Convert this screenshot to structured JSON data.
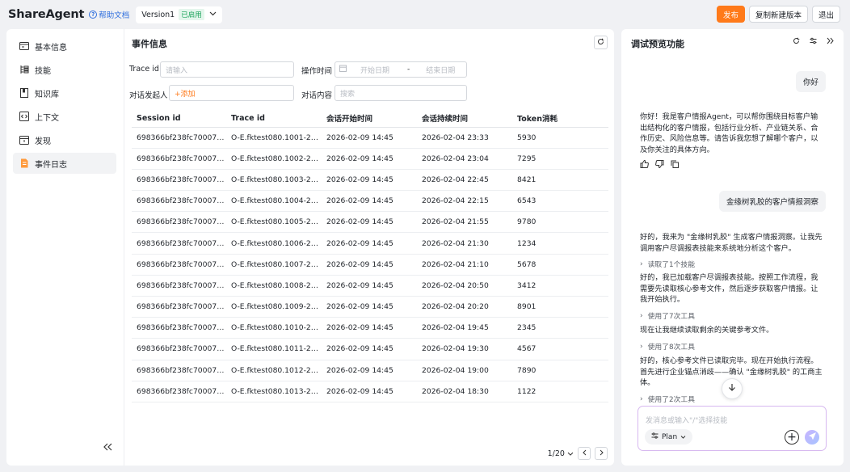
{
  "header": {
    "brand": "ShareAgent",
    "help_label": "帮助文档",
    "version_label": "Version1",
    "version_status": "已启用",
    "publish_label": "发布",
    "copy_label": "复制新建版本",
    "exit_label": "退出",
    "colors": {
      "accent": "#ff7a1a",
      "link": "#2f6fde",
      "status": "#1aa35a"
    }
  },
  "sidebar": {
    "items": [
      {
        "label": "基本信息",
        "icon": "info-card-icon"
      },
      {
        "label": "技能",
        "icon": "skill-list-icon"
      },
      {
        "label": "知识库",
        "icon": "book-icon"
      },
      {
        "label": "上下文",
        "icon": "code-icon"
      },
      {
        "label": "发现",
        "icon": "calendar-icon"
      },
      {
        "label": "事件日志",
        "icon": "log-document-icon",
        "active": true
      }
    ],
    "collapse_icon": "double-chevron-left-icon"
  },
  "main": {
    "title": "事件信息",
    "filters": {
      "trace_label": "Trace id",
      "trace_placeholder": "请输入",
      "time_label": "操作时间",
      "start_placeholder": "开始日期",
      "range_sep": "-",
      "end_placeholder": "结束日期",
      "initiator_label": "对话发起人",
      "initiator_add": "+添加",
      "content_label": "对话内容",
      "content_placeholder": "搜索"
    },
    "columns": [
      "Session id",
      "Trace id",
      "会话开始时间",
      "会话持续时间",
      "Token消耗"
    ],
    "rows": [
      [
        "698366bf238fc70007c…",
        "O-E.fktest080.1001-26…",
        "2026-02-09 14:45",
        "2026-02-04 23:33",
        "5930"
      ],
      [
        "698366bf238fc70007c…",
        "O-E.fktest080.1002-26…",
        "2026-02-09 14:45",
        "2026-02-04 23:04",
        "7295"
      ],
      [
        "698366bf238fc70007c…",
        "O-E.fktest080.1003-26…",
        "2026-02-09 14:45",
        "2026-02-04 22:45",
        "8421"
      ],
      [
        "698366bf238fc70007c…",
        "O-E.fktest080.1004-26…",
        "2026-02-09 14:45",
        "2026-02-04 22:15",
        "6543"
      ],
      [
        "698366bf238fc70007c…",
        "O-E.fktest080.1005-26…",
        "2026-02-09 14:45",
        "2026-02-04 21:55",
        "9780"
      ],
      [
        "698366bf238fc70007c…",
        "O-E.fktest080.1006-26…",
        "2026-02-09 14:45",
        "2026-02-04 21:30",
        "1234"
      ],
      [
        "698366bf238fc70007c…",
        "O-E.fktest080.1007-26…",
        "2026-02-09 14:45",
        "2026-02-04 21:10",
        "5678"
      ],
      [
        "698366bf238fc70007c…",
        "O-E.fktest080.1008-26…",
        "2026-02-09 14:45",
        "2026-02-04 20:50",
        "3412"
      ],
      [
        "698366bf238fc70007c…",
        "O-E.fktest080.1009-26…",
        "2026-02-09 14:45",
        "2026-02-04 20:20",
        "8901"
      ],
      [
        "698366bf238fc70007c…",
        "O-E.fktest080.1010-26…",
        "2026-02-09 14:45",
        "2026-02-04 19:45",
        "2345"
      ],
      [
        "698366bf238fc70007c…",
        "O-E.fktest080.1011-26…",
        "2026-02-09 14:45",
        "2026-02-04 19:30",
        "4567"
      ],
      [
        "698366bf238fc70007c…",
        "O-E.fktest080.1012-26…",
        "2026-02-09 14:45",
        "2026-02-04 19:00",
        "7890"
      ],
      [
        "698366bf238fc70007c…",
        "O-E.fktest080.1013-26…",
        "2026-02-09 14:45",
        "2026-02-04 18:30",
        "1122"
      ]
    ],
    "pager": {
      "page_label": "1/20"
    }
  },
  "chat": {
    "title": "调试预览功能",
    "user_msg_1": "你好",
    "bot_msg_1": "你好！我是客户情报Agent，可以帮你围绕目标客户输出结构化的客户情报，包括行业分析、产业链关系、合作历史、风险信息等。请告诉我您想了解哪个客户，以及你关注的具体方向。",
    "user_msg_2": "金缘树乳胶的客户情报洞察",
    "bot_msg_2": "好的，我来为 \"金缘树乳胶\" 生成客户情报洞察。让我先调用客户尽调报表技能来系统地分析这个客户。",
    "tool_1": "读取了1个技能",
    "bot_msg_3": "好的，我已加载客户尽调报表技能。按照工作流程，我需要先读取核心参考文件，然后逐步获取客户情报。让我开始执行。",
    "tool_2": "使用了7次工具",
    "bot_msg_4": "现在让我继续读取剩余的关键参考文件。",
    "tool_3": "使用了8次工具",
    "bot_msg_5": "好的，核心参考文件已读取完毕。现在开始执行流程。首先进行企业锚点消歧——确认 \"金缘树乳胶\" 的工商主体。",
    "tool_4": "使用了2次工具",
    "input_placeholder": "发消息或输入\"/\"选择技能",
    "plan_label": "Plan"
  }
}
